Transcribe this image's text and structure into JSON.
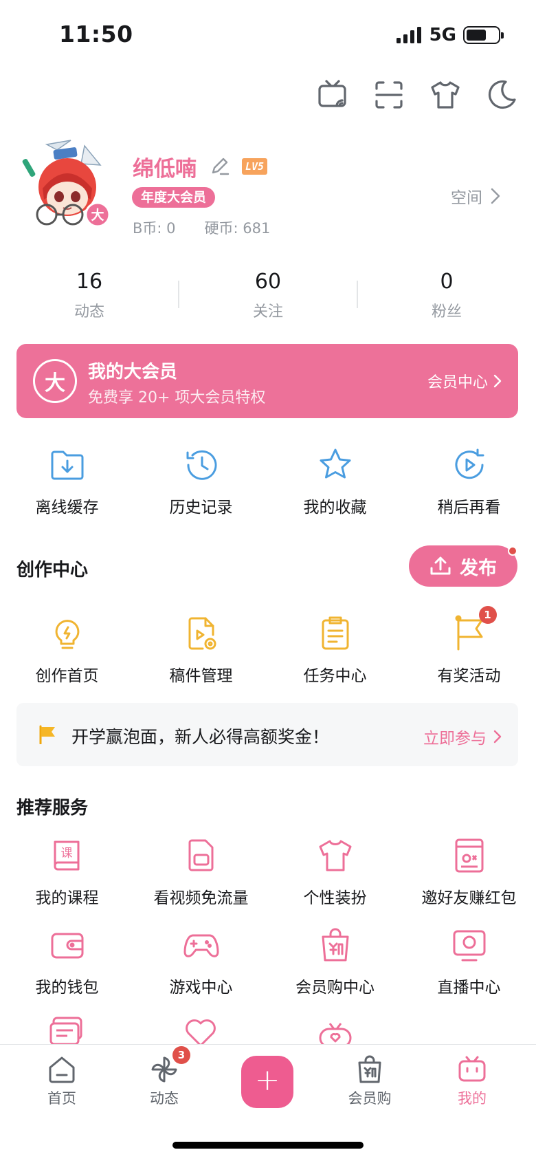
{
  "status_bar": {
    "time": "11:50",
    "network": "5G"
  },
  "profile": {
    "username": "绵低喃",
    "level": "LV5",
    "vip_tag": "年度大会员",
    "b_coins": "B币: 0",
    "hard_coins": "硬币: 681",
    "space_link": "空间",
    "avatar_badge": "大"
  },
  "stats": [
    {
      "value": "16",
      "label": "动态"
    },
    {
      "value": "60",
      "label": "关注"
    },
    {
      "value": "0",
      "label": "粉丝"
    }
  ],
  "vip_banner": {
    "logo": "大",
    "title": "我的大会员",
    "subtitle": "免费享 20+ 项大会员特权",
    "cta": "会员中心"
  },
  "quick_actions": [
    {
      "label": "离线缓存",
      "icon": "download-folder-icon"
    },
    {
      "label": "历史记录",
      "icon": "history-clock-icon"
    },
    {
      "label": "我的收藏",
      "icon": "star-icon"
    },
    {
      "label": "稍后再看",
      "icon": "watch-later-icon"
    }
  ],
  "creation": {
    "title": "创作中心",
    "publish_label": "发布",
    "items": [
      {
        "label": "创作首页",
        "icon": "lightbulb-icon"
      },
      {
        "label": "稿件管理",
        "icon": "manuscript-icon"
      },
      {
        "label": "任务中心",
        "icon": "clipboard-icon"
      },
      {
        "label": "有奖活动",
        "icon": "flag-icon",
        "badge": "1"
      }
    ]
  },
  "promo": {
    "text": "开学赢泡面，新人必得高额奖金！",
    "cta": "立即参与"
  },
  "services": {
    "title": "推荐服务",
    "items": [
      {
        "label": "我的课程",
        "icon": "course-book-icon"
      },
      {
        "label": "看视频免流量",
        "icon": "sim-card-icon"
      },
      {
        "label": "个性装扮",
        "icon": "tshirt-icon"
      },
      {
        "label": "邀好友赚红包",
        "icon": "red-envelope-icon"
      },
      {
        "label": "我的钱包",
        "icon": "wallet-icon"
      },
      {
        "label": "游戏中心",
        "icon": "gamepad-icon"
      },
      {
        "label": "会员购中心",
        "icon": "shopping-bag-icon"
      },
      {
        "label": "直播中心",
        "icon": "live-tv-icon"
      }
    ]
  },
  "tabbar": {
    "tabs": [
      {
        "label": "首页",
        "icon": "home-icon"
      },
      {
        "label": "动态",
        "icon": "pinwheel-icon",
        "badge": "3"
      },
      {
        "label": "会员购",
        "icon": "shopping-bag-icon"
      },
      {
        "label": "我的",
        "icon": "bilibili-tv-icon"
      }
    ],
    "plus": "+"
  },
  "colors": {
    "accent": "#ed6f98",
    "icon_blue": "#4a9de0",
    "icon_yellow": "#f0b431",
    "text": "#18191c",
    "muted": "#9499a0"
  }
}
